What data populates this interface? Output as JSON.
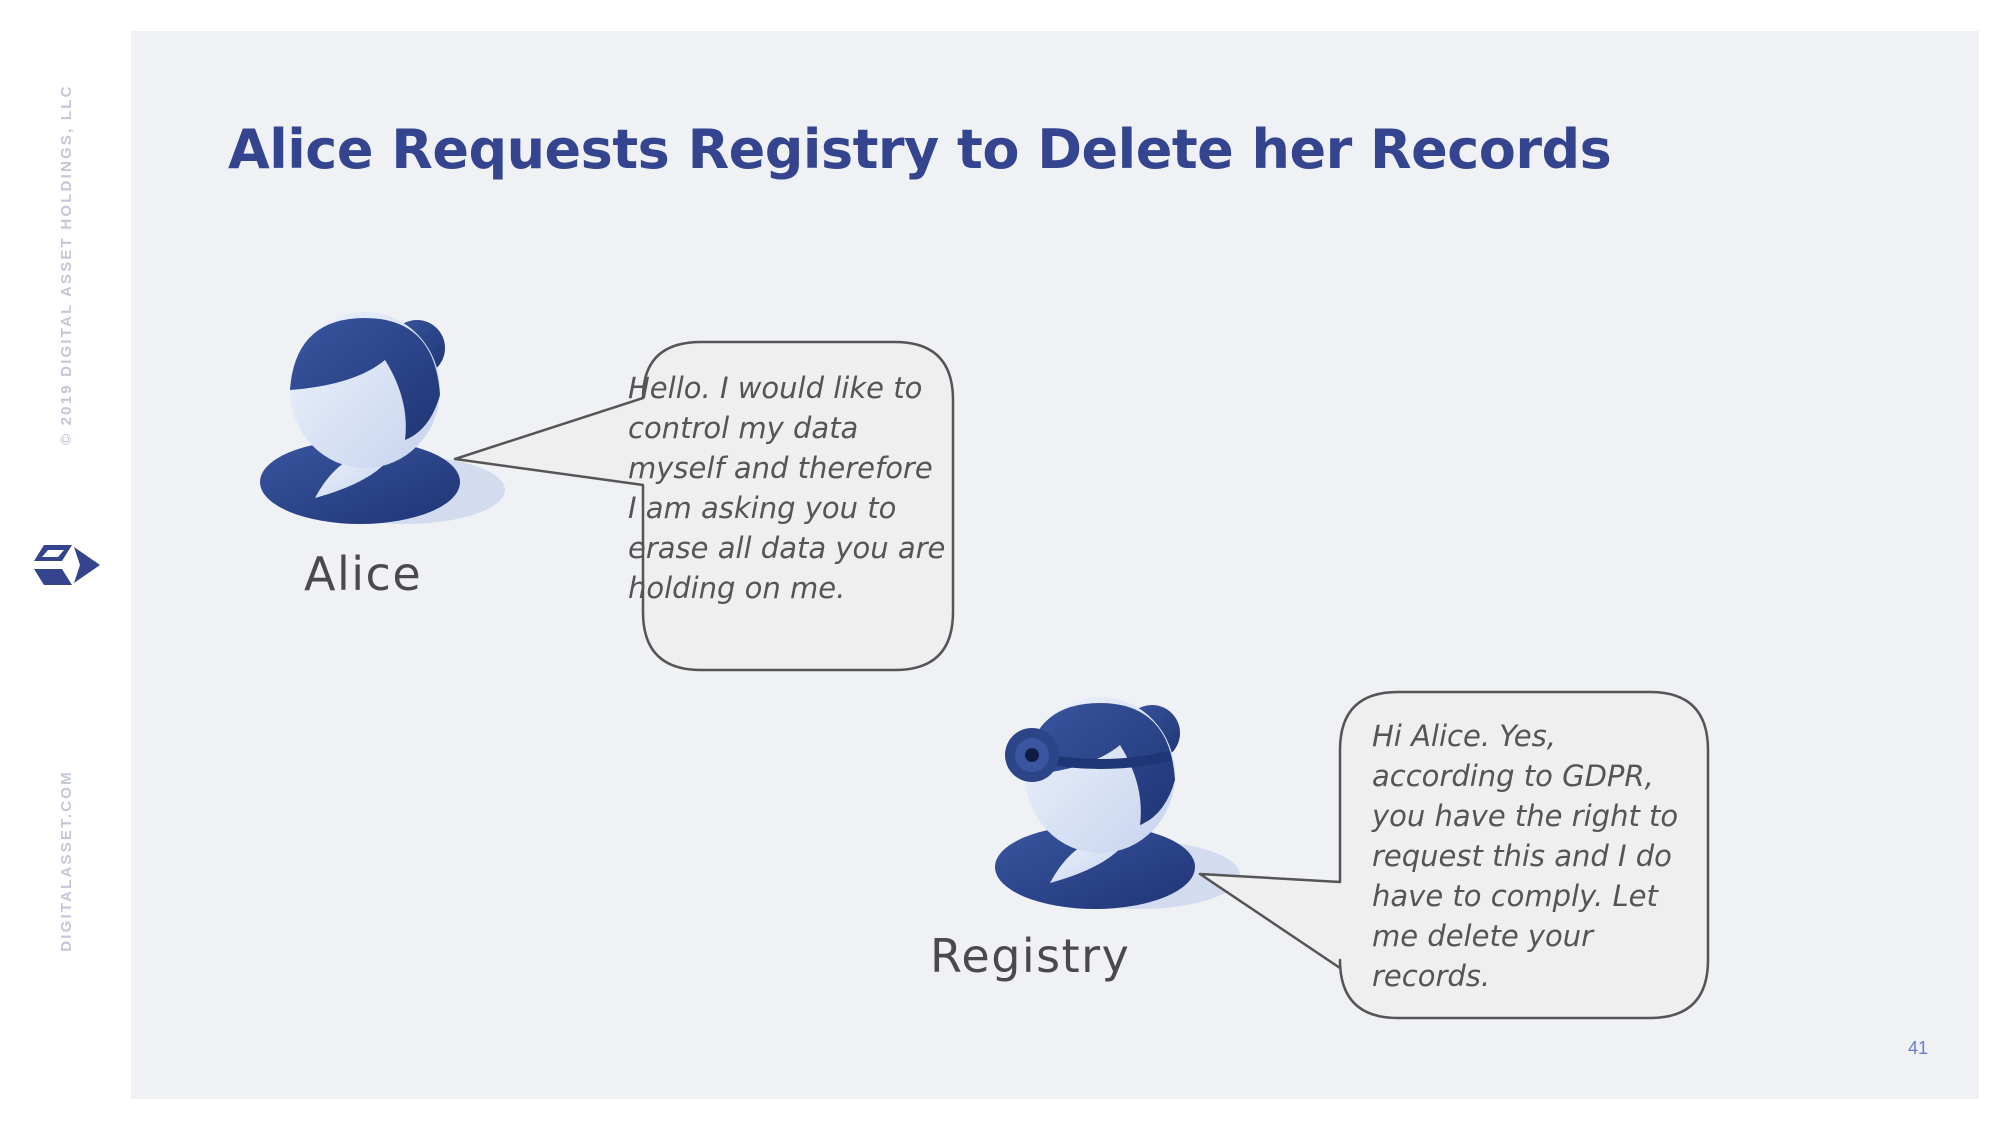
{
  "slide": {
    "title": "Alice Requests Registry to Delete her Records",
    "page_number": "41"
  },
  "sidebar": {
    "copyright": "© 2019 DIGITAL ASSET HOLDINGS, LLC",
    "website": "DIGITALASSET.COM",
    "logo_icon": "digital-asset-logo-icon"
  },
  "participants": {
    "alice": {
      "name": "Alice",
      "icon": "person-avatar-icon",
      "message": "Hello. I would like to control my data myself and therefore I am asking you to erase all data you are holding on me."
    },
    "registry": {
      "name": "Registry",
      "icon": "doctor-avatar-icon",
      "message": "Hi Alice. Yes, according to GDPR, you have the right to request this and I do have to comply. Let me delete your records."
    }
  },
  "colors": {
    "title": "#34448f",
    "avatar_dark": "#2c4488",
    "avatar_light": "#dde6f7",
    "panel_bg": "#f0f1f5",
    "bubble_fill": "#efefef",
    "bubble_stroke": "#555555",
    "sidebar_text": "#c3c7d8",
    "page_number": "#6a7ed0"
  }
}
